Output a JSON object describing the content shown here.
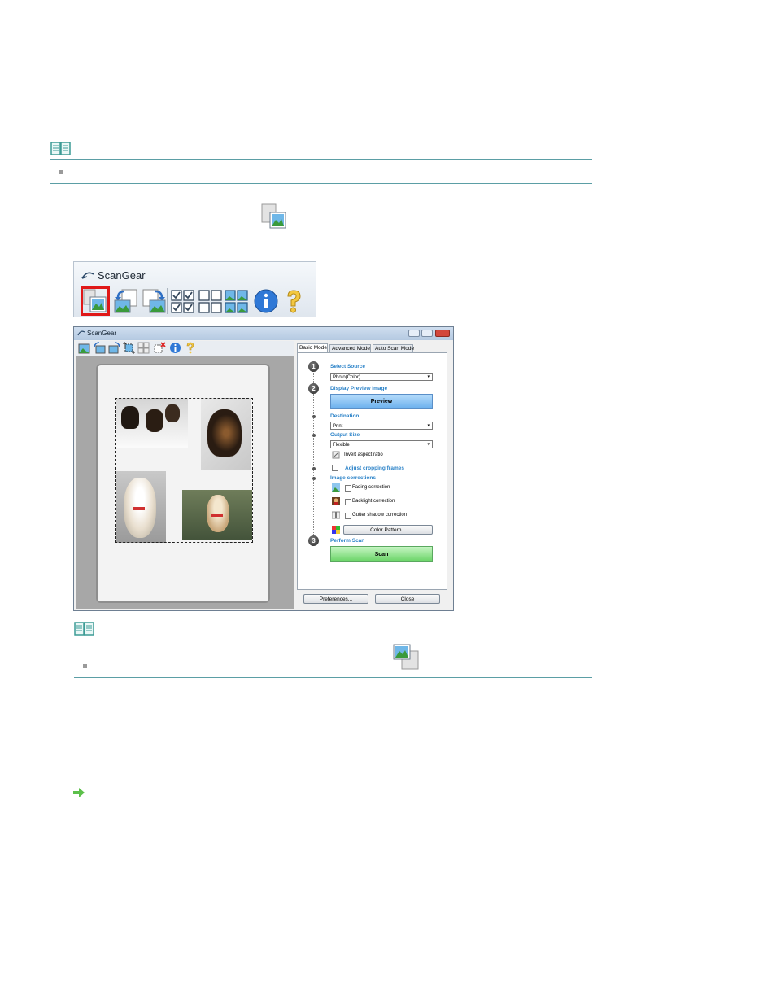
{
  "toolbar_screenshot": {
    "app_title": "ScanGear"
  },
  "window": {
    "title": "ScanGear",
    "tabs": [
      "Basic Mode",
      "Advanced Mode",
      "Auto Scan Mode"
    ],
    "sections": {
      "select_source": "Select Source",
      "source_value": "Photo(Color)",
      "display_preview": "Display Preview Image",
      "preview_button": "Preview",
      "destination": "Destination",
      "destination_value": "Print",
      "output_size": "Output Size",
      "output_size_value": "Flexible",
      "invert_aspect": "Invert aspect ratio",
      "adjust_cropping": "Adjust cropping frames",
      "image_corrections": "Image corrections",
      "fading": "Fading correction",
      "backlight": "Backlight correction",
      "gutter": "Gutter shadow correction",
      "color_pattern": "Color Pattern...",
      "perform_scan": "Perform Scan",
      "scan_button": "Scan"
    },
    "footer": {
      "preferences": "Preferences...",
      "close": "Close"
    }
  },
  "colors": {
    "rule": "#5b9ea5",
    "section_blue": "#2a82c8",
    "arrow_green": "#5cc04a"
  }
}
